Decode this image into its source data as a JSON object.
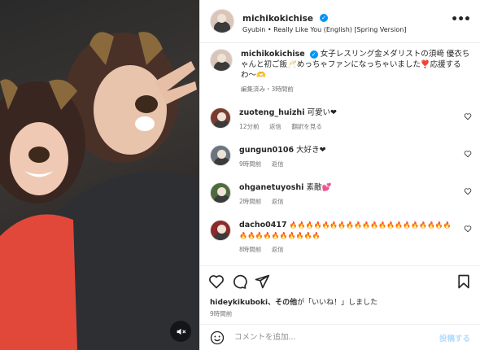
{
  "post": {
    "username": "michikokichise",
    "audio": "Gyubin • Really Like You (English) [Spring Version]",
    "caption": "女子レスリング金メダリストの須﨑 優衣ちゃんと初ご飯🥂めっちゃファンになっちゃいました❣️応援するわ〜🫶",
    "caption_meta": "編集済み・3時間前"
  },
  "comments": [
    {
      "user": "zuoteng_huizhi",
      "text": "可愛い❤",
      "time": "12分前",
      "reply": "返信",
      "translate": "翻訳を見る",
      "avatar_color": "#7a3b2e"
    },
    {
      "user": "gungun0106",
      "text": "大好き❤",
      "time": "9時間前",
      "reply": "返信",
      "avatar_color": "#6a7580"
    },
    {
      "user": "ohganetuyoshi",
      "text": "素敵💕",
      "time": "2時間前",
      "reply": "返信",
      "avatar_color": "#4f6b3e"
    },
    {
      "user": "dacho0417",
      "text": "🔥🔥🔥🔥🔥🔥🔥🔥🔥🔥🔥🔥🔥🔥🔥🔥🔥🔥🔥🔥🔥🔥🔥🔥🔥🔥🔥🔥🔥🔥",
      "time": "8時間前",
      "reply": "返信",
      "avatar_color": "#8c2a2a"
    }
  ],
  "likes": {
    "text_prefix": "hideykikuboki",
    "text_mid": "、その他",
    "text_suffix": "が「いいね！」しました",
    "time": "9時間前"
  },
  "add_comment": {
    "placeholder": "コメントを追加...",
    "post_label": "投稿する"
  },
  "colors": {
    "accent": "#0095f6",
    "heart": "#262626"
  }
}
